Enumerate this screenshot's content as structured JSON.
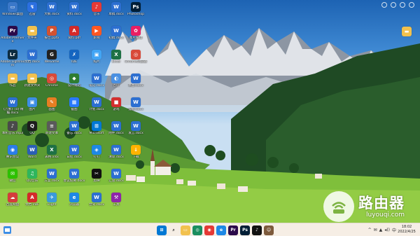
{
  "desktop": {
    "icons": [
      {
        "label": "Windows桌面",
        "glyph": "▭",
        "color": "#3a78c9"
      },
      {
        "label": "Adobe Premiere",
        "glyph": "Pr",
        "color": "#2b0a4a"
      },
      {
        "label": "Adobe Lightroom",
        "glyph": "Lr",
        "color": "#0c2c40"
      },
      {
        "label": "作品",
        "glyph": "▬",
        "color": "#f2c14e"
      },
      {
        "label": "《万象》(0)-精编.docx",
        "glyph": "W",
        "color": "#2c6fd1"
      },
      {
        "label": "本机音乐.mp3",
        "glyph": "♪",
        "color": "#4a4a4a"
      },
      {
        "label": "腾讯会议",
        "glyph": "◉",
        "color": "#2b7de9"
      },
      {
        "label": "微信",
        "glyph": "✉",
        "color": "#2dc100"
      },
      {
        "label": "百度网盘",
        "glyph": "☁",
        "color": "#d43c3c"
      },
      {
        "label": "迅雷",
        "glyph": "↯",
        "color": "#2b6fe0"
      },
      {
        "label": "文件夹",
        "glyph": "▬",
        "color": "#f2c14e"
      },
      {
        "label": "文档.docx",
        "glyph": "W",
        "color": "#2c6fd1"
      },
      {
        "label": "新建文件夹",
        "glyph": "▬",
        "color": "#f2c14e"
      },
      {
        "label": "图片",
        "glyph": "▣",
        "color": "#3d8ee6"
      },
      {
        "label": "QQ",
        "glyph": "Q",
        "color": "#1d1d1d"
      },
      {
        "label": "Word",
        "glyph": "W",
        "color": "#2b5fb6"
      },
      {
        "label": "QQ音乐",
        "glyph": "♫",
        "color": "#2fb65c"
      },
      {
        "label": "文档 PDF",
        "glyph": "A",
        "color": "#d42a2a"
      },
      {
        "label": "大纲.docx",
        "glyph": "W",
        "color": "#2c6fd1"
      },
      {
        "label": "报告.pptx",
        "glyph": "P",
        "color": "#d35230"
      },
      {
        "label": "WeGame",
        "glyph": "G",
        "color": "#222222"
      },
      {
        "label": "Chrome",
        "glyph": "◎",
        "color": "#d84a3a"
      },
      {
        "label": "画图",
        "glyph": "✎",
        "color": "#e67e22"
      },
      {
        "label": "新建文本",
        "glyph": "≡",
        "color": "#5a5a5a"
      },
      {
        "label": "表格.xlsx",
        "glyph": "X",
        "color": "#1e7145"
      },
      {
        "label": "方案.docx",
        "glyph": "W",
        "color": "#2c6fd1"
      },
      {
        "label": "Flight",
        "glyph": "✈",
        "color": "#3a9ad9"
      },
      {
        "label": "资料.docx",
        "glyph": "W",
        "color": "#2c6fd1"
      },
      {
        "label": "资料.pdf",
        "glyph": "A",
        "color": "#d42a2a"
      },
      {
        "label": "IDE",
        "glyph": "✗",
        "color": "#1565c0"
      },
      {
        "label": "设计规范",
        "glyph": "◆",
        "color": "#2e7d32"
      },
      {
        "label": "截图",
        "glyph": "▦",
        "color": "#2979ff"
      },
      {
        "label": "备忘.docx",
        "glyph": "W",
        "color": "#2c6fd1"
      },
      {
        "label": "日程.docx",
        "glyph": "W",
        "color": "#2c6fd1"
      },
      {
        "label": "会议纪要.docx",
        "glyph": "W",
        "color": "#2c6fd1"
      },
      {
        "label": "浏览器",
        "glyph": "e",
        "color": "#1e88e5"
      },
      {
        "label": "音乐",
        "glyph": "♪",
        "color": "#e53935"
      },
      {
        "label": "影视",
        "glyph": "▶",
        "color": "#ff5722"
      },
      {
        "label": "照片",
        "glyph": "▣",
        "color": "#42a5f5"
      },
      {
        "label": "笔记.docx",
        "glyph": "W",
        "color": "#2c6fd1"
      },
      {
        "label": "计划.docx",
        "glyph": "W",
        "color": "#2c6fd1"
      },
      {
        "label": "Microsoft",
        "glyph": "⊞",
        "color": "#0078d4"
      },
      {
        "label": "钉钉",
        "glyph": "◈",
        "color": "#1e88e5"
      },
      {
        "label": "剪映",
        "glyph": "✂",
        "color": "#111111"
      },
      {
        "label": "合同.docx",
        "glyph": "W",
        "color": "#2c6fd1"
      },
      {
        "label": "草稿.docx",
        "glyph": "W",
        "color": "#2c6fd1"
      },
      {
        "label": "初稿.docx",
        "glyph": "W",
        "color": "#2c6fd1"
      },
      {
        "label": "Excel",
        "glyph": "X",
        "color": "#1e7145"
      },
      {
        "label": "百度",
        "glyph": "◐",
        "color": "#4a90e2"
      },
      {
        "label": "游戏",
        "glyph": "■",
        "color": "#d32f2f"
      },
      {
        "label": "附件.docx",
        "glyph": "W",
        "color": "#2c6fd1"
      },
      {
        "label": "清单.docx",
        "glyph": "W",
        "color": "#2c6fd1"
      },
      {
        "label": "汇总.docx",
        "glyph": "W",
        "color": "#2c6fd1"
      },
      {
        "label": "工具",
        "glyph": "⚒",
        "color": "#8e24aa"
      },
      {
        "label": "Photoshop",
        "glyph": "Ps",
        "color": "#001e36"
      },
      {
        "label": "图片编辑",
        "glyph": "✿",
        "color": "#e91e63"
      },
      {
        "label": "Chrome浏览器",
        "glyph": "◎",
        "color": "#d84a3a"
      },
      {
        "label": "草图.docx",
        "glyph": "W",
        "color": "#2c6fd1"
      },
      {
        "label": "提纲.docx",
        "glyph": "W",
        "color": "#2c6fd1"
      },
      {
        "label": "发言.docx",
        "glyph": "W",
        "color": "#2c6fd1"
      },
      {
        "label": "下载",
        "glyph": "↓",
        "color": "#ffb300"
      }
    ]
  },
  "watermark": {
    "title": "路由器",
    "url": "luyouqi.com"
  },
  "taskbar": {
    "apps": [
      {
        "glyph": "⊞",
        "color": "#0078d4"
      },
      {
        "glyph": "⌕",
        "color": "#333333"
      },
      {
        "glyph": "▭",
        "color": "#f2c14e"
      },
      {
        "glyph": "◎",
        "color": "#1a8e5f"
      },
      {
        "glyph": "◉",
        "color": "#e53935"
      },
      {
        "glyph": "e",
        "color": "#1e88e5"
      },
      {
        "glyph": "Pr",
        "color": "#2b0a4a"
      },
      {
        "glyph": "Ps",
        "color": "#001e36"
      },
      {
        "glyph": "♪",
        "color": "#111111"
      },
      {
        "glyph": "☺",
        "color": "#7d5a3c"
      }
    ],
    "clock": {
      "time": "18:02",
      "date": "2022/4/25"
    },
    "tray": [
      "^",
      "✉",
      "▲",
      "◂))",
      "中"
    ]
  }
}
